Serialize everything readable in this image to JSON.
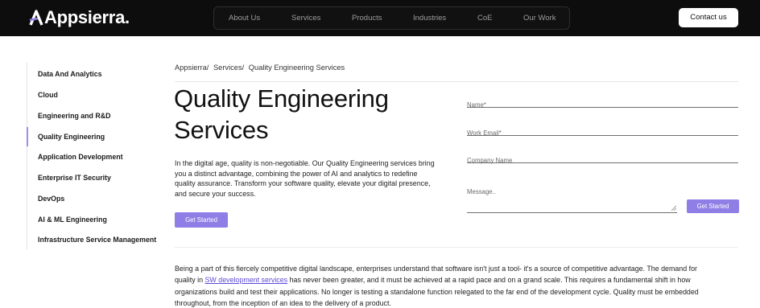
{
  "brand": {
    "name": "Appsierra."
  },
  "nav": {
    "items": [
      {
        "label": "About Us"
      },
      {
        "label": "Services"
      },
      {
        "label": "Products"
      },
      {
        "label": "Industries"
      },
      {
        "label": "CoE"
      },
      {
        "label": "Our Work"
      }
    ],
    "cta_label": "Contact us"
  },
  "sidebar": {
    "items": [
      {
        "label": "Data And Analytics"
      },
      {
        "label": "Cloud"
      },
      {
        "label": "Engineering and R&D"
      },
      {
        "label": "Quality Engineering",
        "active": true
      },
      {
        "label": "Application Development"
      },
      {
        "label": "Enterprise IT Security"
      },
      {
        "label": "DevOps"
      },
      {
        "label": "AI & ML Engineering"
      },
      {
        "label": "Infrastructure Service Management"
      }
    ]
  },
  "breadcrumb": [
    "Appsierra/",
    "Services/",
    "Quality Engineering Services"
  ],
  "main": {
    "title_line1": "Quality Engineering",
    "title_line2": "Services",
    "intro_lines": [
      "In the digital age, quality is non-negotiable. Our Quality Engineering services bring",
      "you a distinct advantage, combining the power of AI and analytics to redefine",
      "quality assurance. Transform your software quality, elevate your digital presence,",
      "and secure your success."
    ],
    "cta_label": "Get Started"
  },
  "form": {
    "name_placeholder": "Name*",
    "email_placeholder": "Work Email*",
    "company_placeholder": "Company Name",
    "message_placeholder": "Message..",
    "submit_label": "Get Started"
  },
  "body": {
    "line1": "Being a part of this fiercely competitive digital landscape, enterprises understand that software isn't just a tool- it's a source of competitive advantage. The demand for",
    "line2_before": "quality in ",
    "line2_link": "SW development services",
    "line2_after": " has never been greater, and it must be achieved at a rapid pace and on a grand scale. This requires a fundamental shift in how",
    "line3": "organizations build and test their applications. No longer is testing a standalone function relegated to the far end of the development cycle. Quality must be embedded",
    "line4": "throughout, from the inception of an idea to the delivery of a product."
  },
  "colors": {
    "header_bg": "#0d0d0d",
    "accent": "#8f7ee6",
    "link": "#5b4ad6"
  }
}
